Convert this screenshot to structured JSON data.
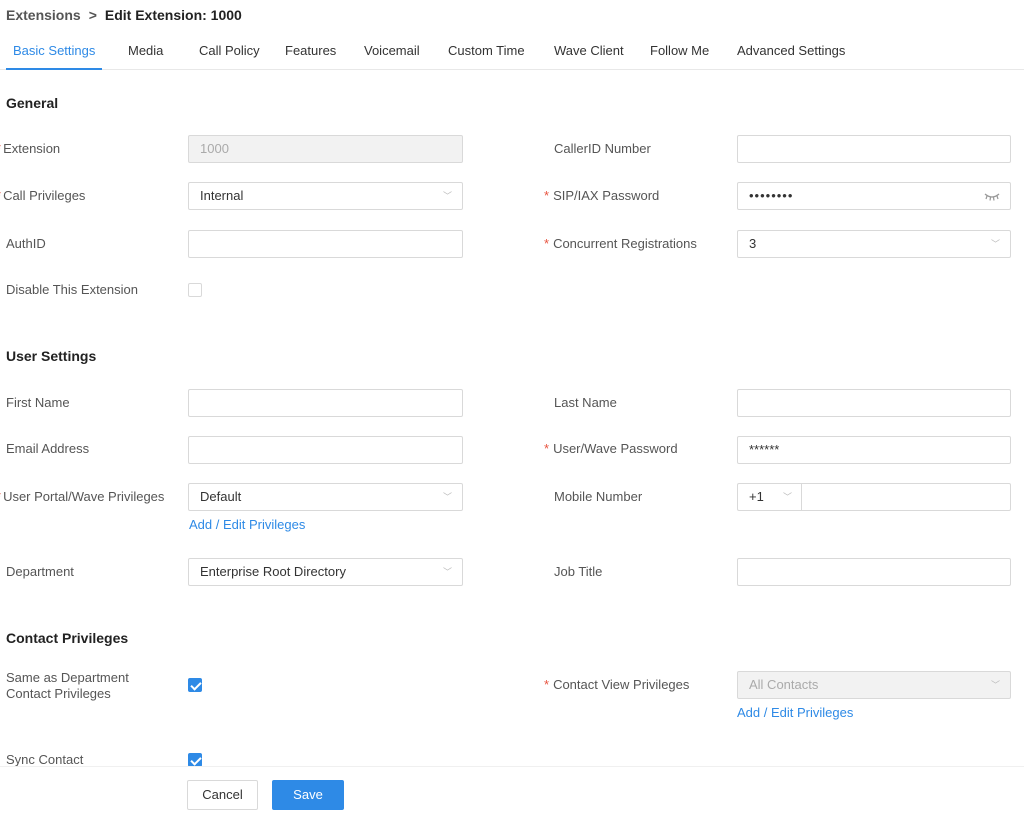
{
  "breadcrumb": {
    "root": "Extensions",
    "separator": ">",
    "current": "Edit Extension: 1000"
  },
  "tabs": [
    {
      "label": "Basic Settings",
      "active": true
    },
    {
      "label": "Media"
    },
    {
      "label": "Call Policy"
    },
    {
      "label": "Features"
    },
    {
      "label": "Voicemail"
    },
    {
      "label": "Custom Time"
    },
    {
      "label": "Wave Client"
    },
    {
      "label": "Follow Me"
    },
    {
      "label": "Advanced Settings"
    }
  ],
  "general": {
    "title": "General",
    "extension": {
      "label": "Extension",
      "value": "1000"
    },
    "callerid_number": {
      "label": "CallerID Number",
      "value": ""
    },
    "call_privileges": {
      "label": "Call Privileges",
      "value": "Internal"
    },
    "sip_password": {
      "label": "SIP/IAX Password",
      "value": "••••••••"
    },
    "authid": {
      "label": "AuthID",
      "value": ""
    },
    "concurrent_registrations": {
      "label": "Concurrent Registrations",
      "value": "3"
    },
    "disable_extension": {
      "label": "Disable This Extension",
      "checked": false
    }
  },
  "user_settings": {
    "title": "User Settings",
    "first_name": {
      "label": "First Name",
      "value": ""
    },
    "last_name": {
      "label": "Last Name",
      "value": ""
    },
    "email": {
      "label": "Email Address",
      "value": ""
    },
    "wave_password": {
      "label": "User/Wave Password",
      "value": "******"
    },
    "portal_privileges": {
      "label": "User Portal/Wave Privileges",
      "value": "Default",
      "link": "Add / Edit Privileges"
    },
    "mobile_number": {
      "label": "Mobile Number",
      "prefix": "+1",
      "value": ""
    },
    "department": {
      "label": "Department",
      "value": "Enterprise Root Directory"
    },
    "job_title": {
      "label": "Job Title",
      "value": ""
    }
  },
  "contact_privileges": {
    "title": "Contact Privileges",
    "same_as_department": {
      "label_line1": "Same as Department",
      "label_line2": "Contact Privileges",
      "checked": true
    },
    "contact_view": {
      "label": "Contact View Privileges",
      "value": "All Contacts",
      "link": "Add / Edit Privileges"
    },
    "sync_contact": {
      "label": "Sync Contact",
      "checked": true
    }
  },
  "footer": {
    "cancel_label": "Cancel",
    "save_label": "Save"
  },
  "colors": {
    "accent": "#2e8ae6",
    "required": "#e8533f"
  },
  "required_mark": "*",
  "chevron_glyph": "﹀"
}
